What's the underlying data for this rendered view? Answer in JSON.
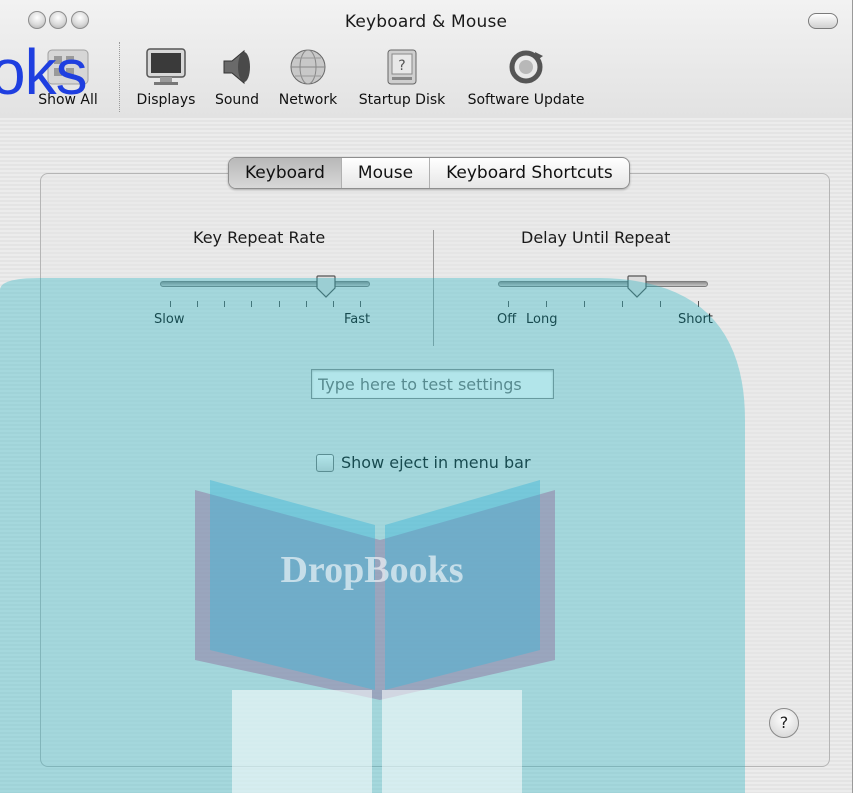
{
  "window": {
    "title": "Keyboard & Mouse"
  },
  "toolbar": {
    "show_all_label": "Show All",
    "items": [
      {
        "label": "Displays",
        "icon": "displays-icon"
      },
      {
        "label": "Sound",
        "icon": "speaker-icon"
      },
      {
        "label": "Network",
        "icon": "globe-icon"
      },
      {
        "label": "Startup Disk",
        "icon": "disk-icon"
      },
      {
        "label": "Software Update",
        "icon": "update-icon"
      }
    ]
  },
  "tabs": [
    {
      "label": "Keyboard",
      "selected": true
    },
    {
      "label": "Mouse",
      "selected": false
    },
    {
      "label": "Keyboard Shortcuts",
      "selected": false
    }
  ],
  "key_repeat": {
    "heading": "Key Repeat Rate",
    "min_label": "Slow",
    "max_label": "Fast",
    "ticks": 8,
    "value_fraction": 0.79
  },
  "delay_repeat": {
    "heading": "Delay Until Repeat",
    "min_label": "Off",
    "low_label": "Long",
    "max_label": "Short",
    "ticks": 6,
    "value_fraction": 0.66
  },
  "test_field": {
    "placeholder": "Type here to test settings"
  },
  "show_eject": {
    "label": "Show eject in menu bar",
    "checked": false
  },
  "help": {
    "label": "?"
  },
  "watermark": {
    "text": "oks",
    "brand": "DropBooks"
  },
  "colors": {
    "watermark_teal": "#22b4c4",
    "watermark_blue": "#1f3fe0"
  }
}
